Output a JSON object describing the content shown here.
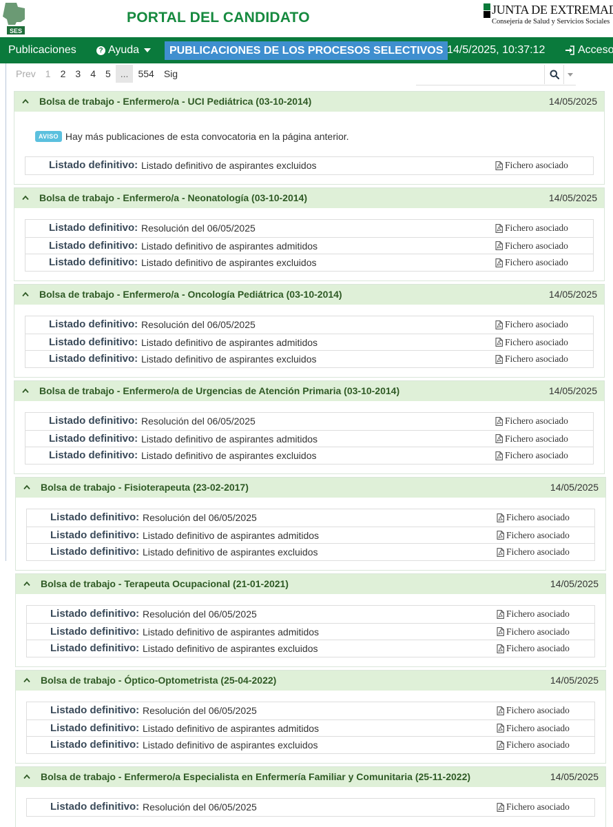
{
  "header": {
    "logo_text": "SES",
    "portal_title": "PORTAL DEL CANDIDATO",
    "junta_name": "JUNTA DE EXTREMADURA",
    "junta_sub": "Consejería de Salud y Servicios Sociales"
  },
  "navbar": {
    "publicaciones": "Publicaciones",
    "ayuda": "Ayuda",
    "active_section": "PUBLICACIONES DE LOS PROCESOS SELECTIVOS",
    "datetime": "14/5/2025, 10:37:12",
    "acceso": "Acceso"
  },
  "pagination": {
    "prev": "Prev",
    "pages": [
      "1",
      "2",
      "3",
      "4",
      "5",
      "...",
      "554"
    ],
    "next": "Sig"
  },
  "search": {
    "placeholder": ""
  },
  "panels": [
    {
      "title": "Bolsa de trabajo - Enfermero/a - UCI Pediátrica (03-10-2014)",
      "date": "14/05/2025",
      "notice_badge": "AVISO",
      "notice_text": "Hay más publicaciones de esta convocatoria en la página anterior.",
      "rows": [
        {
          "label": "Listado definitivo:",
          "text": "Listado definitivo de aspirantes excluidos",
          "file": "Fichero asociado"
        }
      ]
    },
    {
      "title": "Bolsa de trabajo - Enfermero/a - Neonatología (03-10-2014)",
      "date": "14/05/2025",
      "rows": [
        {
          "label": "Listado definitivo:",
          "text": "Resolución del 06/05/2025",
          "file": "Fichero asociado"
        },
        {
          "label": "Listado definitivo:",
          "text": "Listado definitivo de aspirantes admitidos",
          "file": "Fichero asociado"
        },
        {
          "label": "Listado definitivo:",
          "text": "Listado definitivo de aspirantes excluidos",
          "file": "Fichero asociado"
        }
      ]
    },
    {
      "title": "Bolsa de trabajo - Enfermero/a - Oncología Pediátrica (03-10-2014)",
      "date": "14/05/2025",
      "rows": [
        {
          "label": "Listado definitivo:",
          "text": "Resolución del 06/05/2025",
          "file": "Fichero asociado"
        },
        {
          "label": "Listado definitivo:",
          "text": "Listado definitivo de aspirantes admitidos",
          "file": "Fichero asociado"
        },
        {
          "label": "Listado definitivo:",
          "text": "Listado definitivo de aspirantes excluidos",
          "file": "Fichero asociado"
        }
      ]
    },
    {
      "title": "Bolsa de trabajo - Enfermero/a de Urgencias de Atención Primaria (03-10-2014)",
      "date": "14/05/2025",
      "rows": [
        {
          "label": "Listado definitivo:",
          "text": "Resolución del 06/05/2025",
          "file": "Fichero asociado"
        },
        {
          "label": "Listado definitivo:",
          "text": "Listado definitivo de aspirantes admitidos",
          "file": "Fichero asociado"
        },
        {
          "label": "Listado definitivo:",
          "text": "Listado definitivo de aspirantes excluidos",
          "file": "Fichero asociado"
        }
      ]
    },
    {
      "title": "Bolsa de trabajo - Fisioterapeuta (23-02-2017)",
      "date": "14/05/2025",
      "rows": [
        {
          "label": "Listado definitivo:",
          "text": "Resolución del 06/05/2025",
          "file": "Fichero asociado"
        },
        {
          "label": "Listado definitivo:",
          "text": "Listado definitivo de aspirantes admitidos",
          "file": "Fichero asociado"
        },
        {
          "label": "Listado definitivo:",
          "text": "Listado definitivo de aspirantes excluidos",
          "file": "Fichero asociado"
        }
      ]
    },
    {
      "title": "Bolsa de trabajo - Terapeuta Ocupacional (21-01-2021)",
      "date": "14/05/2025",
      "rows": [
        {
          "label": "Listado definitivo:",
          "text": "Resolución del 06/05/2025",
          "file": "Fichero asociado"
        },
        {
          "label": "Listado definitivo:",
          "text": "Listado definitivo de aspirantes admitidos",
          "file": "Fichero asociado"
        },
        {
          "label": "Listado definitivo:",
          "text": "Listado definitivo de aspirantes excluidos",
          "file": "Fichero asociado"
        }
      ]
    },
    {
      "title": "Bolsa de trabajo - Óptico-Optometrista (25-04-2022)",
      "date": "14/05/2025",
      "rows": [
        {
          "label": "Listado definitivo:",
          "text": "Resolución del 06/05/2025",
          "file": "Fichero asociado"
        },
        {
          "label": "Listado definitivo:",
          "text": "Listado definitivo de aspirantes admitidos",
          "file": "Fichero asociado"
        },
        {
          "label": "Listado definitivo:",
          "text": "Listado definitivo de aspirantes excluidos",
          "file": "Fichero asociado"
        }
      ]
    },
    {
      "title": "Bolsa de trabajo - Enfermero/a Especialista en Enfermería Familiar y Comunitaria (25-11-2022)",
      "date": "14/05/2025",
      "rows": [
        {
          "label": "Listado definitivo:",
          "text": "Resolución del 06/05/2025",
          "file": "Fichero asociado"
        }
      ]
    }
  ]
}
